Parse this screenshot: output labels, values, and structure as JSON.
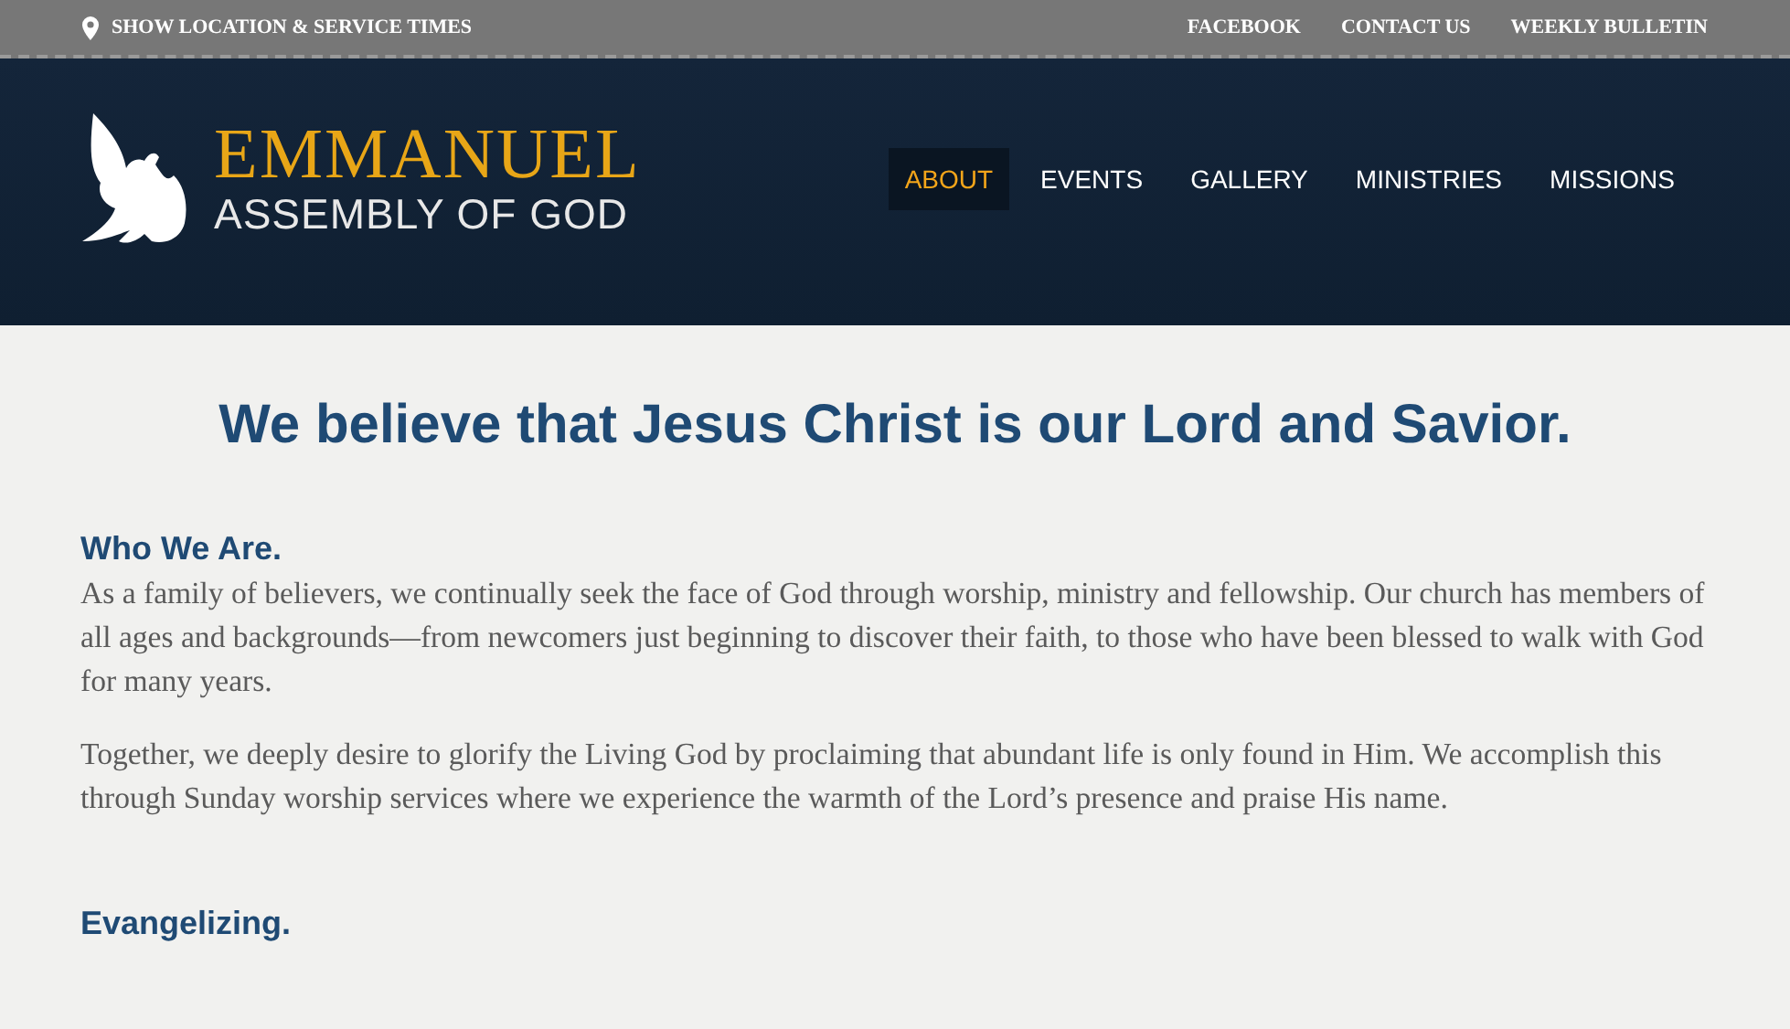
{
  "top_bar": {
    "location_link": "SHOW LOCATION & SERVICE TIMES",
    "links": [
      "FACEBOOK",
      "CONTACT US",
      "WEEKLY BULLETIN"
    ]
  },
  "logo": {
    "name": "EMMANUEL",
    "subtitle": "ASSEMBLY OF GOD"
  },
  "nav": [
    {
      "label": "ABOUT",
      "selected": true
    },
    {
      "label": "EVENTS",
      "selected": false
    },
    {
      "label": "GALLERY",
      "selected": false
    },
    {
      "label": "MINISTRIES",
      "selected": false
    },
    {
      "label": "MISSIONS",
      "selected": false
    }
  ],
  "headline": "We believe that Jesus Christ is our Lord and Savior.",
  "sections": [
    {
      "title": "Who We Are.",
      "paragraphs": [
        "As a family of believers, we continually seek the face of God through worship, ministry and fellowship. Our church has members of all ages and backgrounds—from newcomers just beginning to discover their faith, to those who have been blessed to walk with God for many years.",
        "Together, we deeply desire to glorify the Living God by proclaiming that abundant life is only found in Him. We accomplish this through Sunday worship services where we experience the warmth of the Lord’s presence and praise His name."
      ]
    },
    {
      "title": "Evangelizing."
    }
  ]
}
